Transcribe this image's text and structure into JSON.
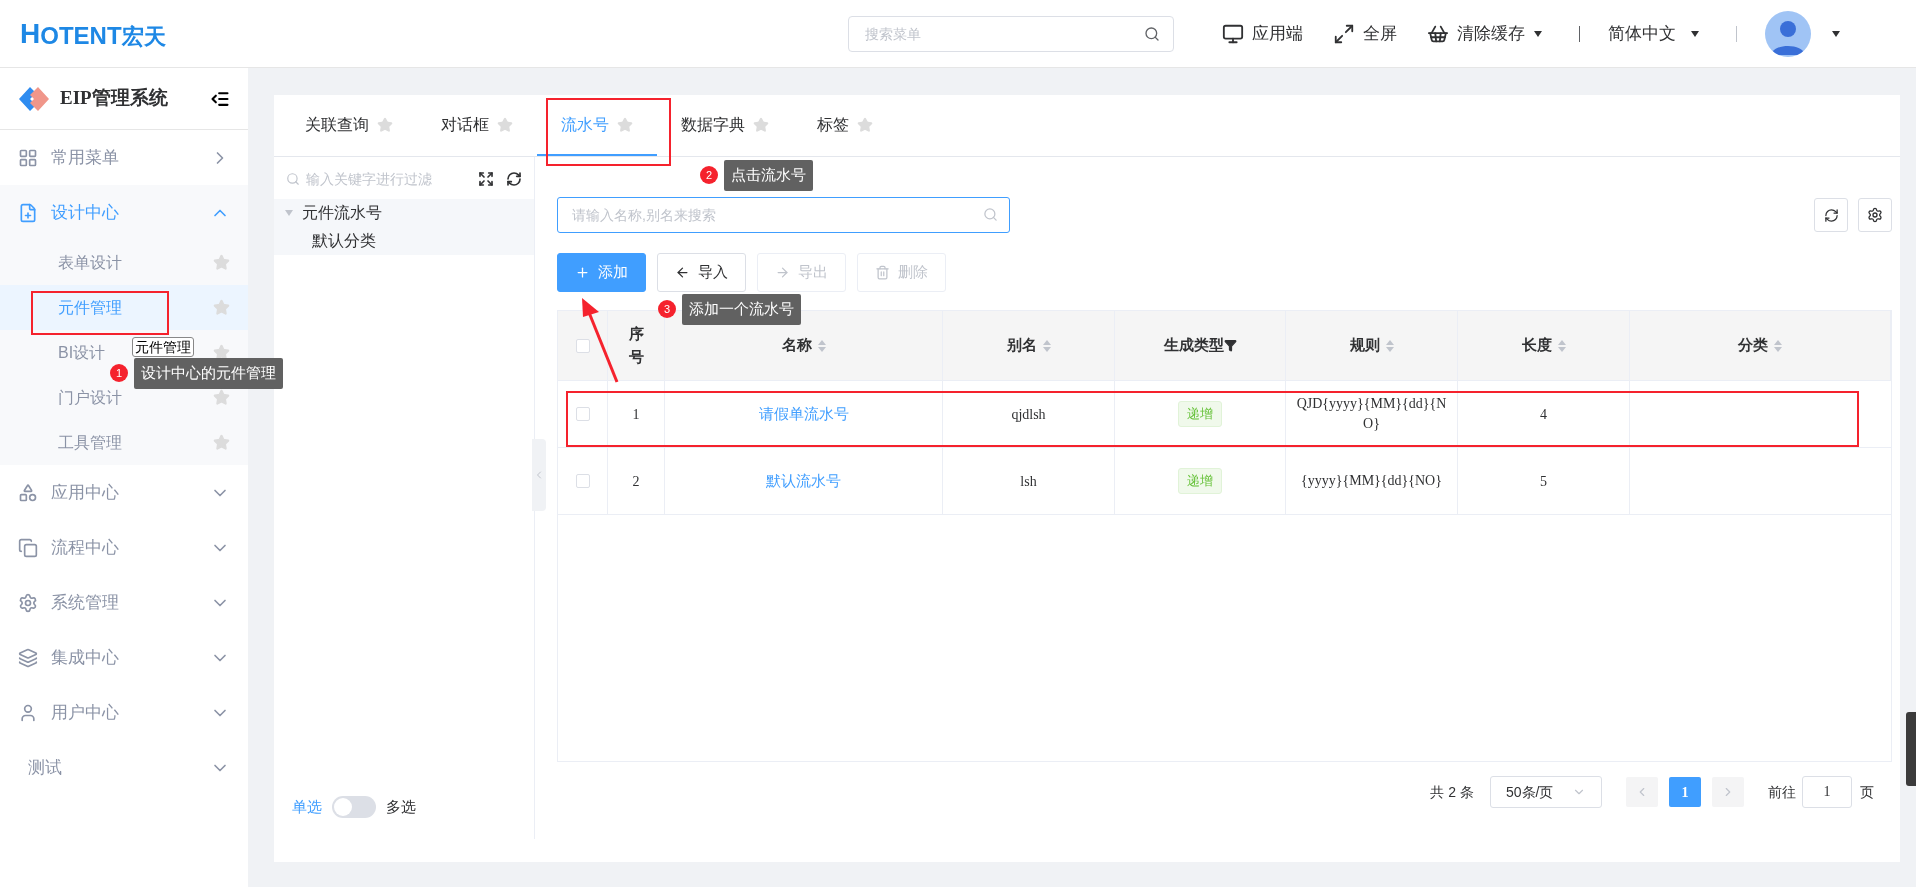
{
  "header": {
    "logo_mark": "H",
    "logo_text": "OTENT",
    "logo_cn": "宏天",
    "search": {
      "placeholder": "搜索菜单"
    },
    "actions": [
      {
        "label": "应用端",
        "dropdown": false
      },
      {
        "label": "全屏",
        "dropdown": false
      },
      {
        "label": "清除缓存",
        "dropdown": true
      }
    ],
    "language": "简体中文"
  },
  "sidebar": {
    "title": "EIP管理系统",
    "items": [
      {
        "label": "常用菜单",
        "expanded": false
      },
      {
        "label": "设计中心",
        "expanded": true,
        "children": [
          {
            "label": "表单设计",
            "selected": false
          },
          {
            "label": "元件管理",
            "selected": true
          },
          {
            "label": "BI设计",
            "selected": false
          },
          {
            "label": "门户设计",
            "selected": false
          },
          {
            "label": "工具管理",
            "selected": false
          }
        ]
      },
      {
        "label": "应用中心",
        "expanded": false
      },
      {
        "label": "流程中心",
        "expanded": false
      },
      {
        "label": "系统管理",
        "expanded": false
      },
      {
        "label": "集成中心",
        "expanded": false
      },
      {
        "label": "用户中心",
        "expanded": false
      },
      {
        "label": "测试",
        "expanded": false
      }
    ]
  },
  "tabs": [
    {
      "label": "关联查询",
      "selected": false
    },
    {
      "label": "对话框",
      "selected": false
    },
    {
      "label": "流水号",
      "selected": true
    },
    {
      "label": "数据字典",
      "selected": false
    },
    {
      "label": "标签",
      "selected": false
    }
  ],
  "tree": {
    "placeholder": "输入关键字进行过滤",
    "nodes": [
      {
        "label": "元件流水号",
        "expanded": true,
        "children": [
          {
            "label": "默认分类"
          }
        ]
      }
    ],
    "mode_switch": {
      "left": "单选",
      "right": "多选",
      "on": false
    }
  },
  "search": {
    "placeholder": "请输入名称,别名来搜索"
  },
  "toolbar": [
    {
      "label": "添加",
      "kind": "primary",
      "disabled": false
    },
    {
      "label": "导入",
      "kind": "import",
      "disabled": false
    },
    {
      "label": "导出",
      "kind": "export",
      "disabled": true
    },
    {
      "label": "删除",
      "kind": "delete",
      "disabled": true
    }
  ],
  "table": {
    "all_checked": false,
    "columns": [
      {
        "label": "序号",
        "kind": "plain"
      },
      {
        "label": "名称",
        "kind": "sort"
      },
      {
        "label": "别名",
        "kind": "sort"
      },
      {
        "label": "生成类型",
        "kind": "filter"
      },
      {
        "label": "规则",
        "kind": "sort"
      },
      {
        "label": "长度",
        "kind": "sort"
      },
      {
        "label": "分类",
        "kind": "sort"
      }
    ],
    "rows": [
      {
        "checked": false,
        "index": "1",
        "name": "请假单流水号",
        "alias": "qjdlsh",
        "type": "递增",
        "rule": "QJD{yyyy}{MM}{dd}{NO}",
        "length": "4"
      },
      {
        "checked": false,
        "index": "2",
        "name": "默认流水号",
        "alias": "lsh",
        "type": "递增",
        "rule": "{yyyy}{MM}{dd}{NO}",
        "length": "5"
      }
    ]
  },
  "pagination": {
    "total": "共 2 条",
    "page_size": "50条/页",
    "pages": [
      {
        "label": "1",
        "selected": true
      }
    ],
    "goto_label": "前往",
    "goto_value": "1",
    "page_unit": "页"
  },
  "annotations": {
    "hover_tooltip": "元件管理",
    "callouts": [
      {
        "number": "1",
        "text": "设计中心的元件管理"
      },
      {
        "number": "2",
        "text": "点击流水号"
      },
      {
        "number": "3",
        "text": "添加一个流水号"
      }
    ]
  }
}
